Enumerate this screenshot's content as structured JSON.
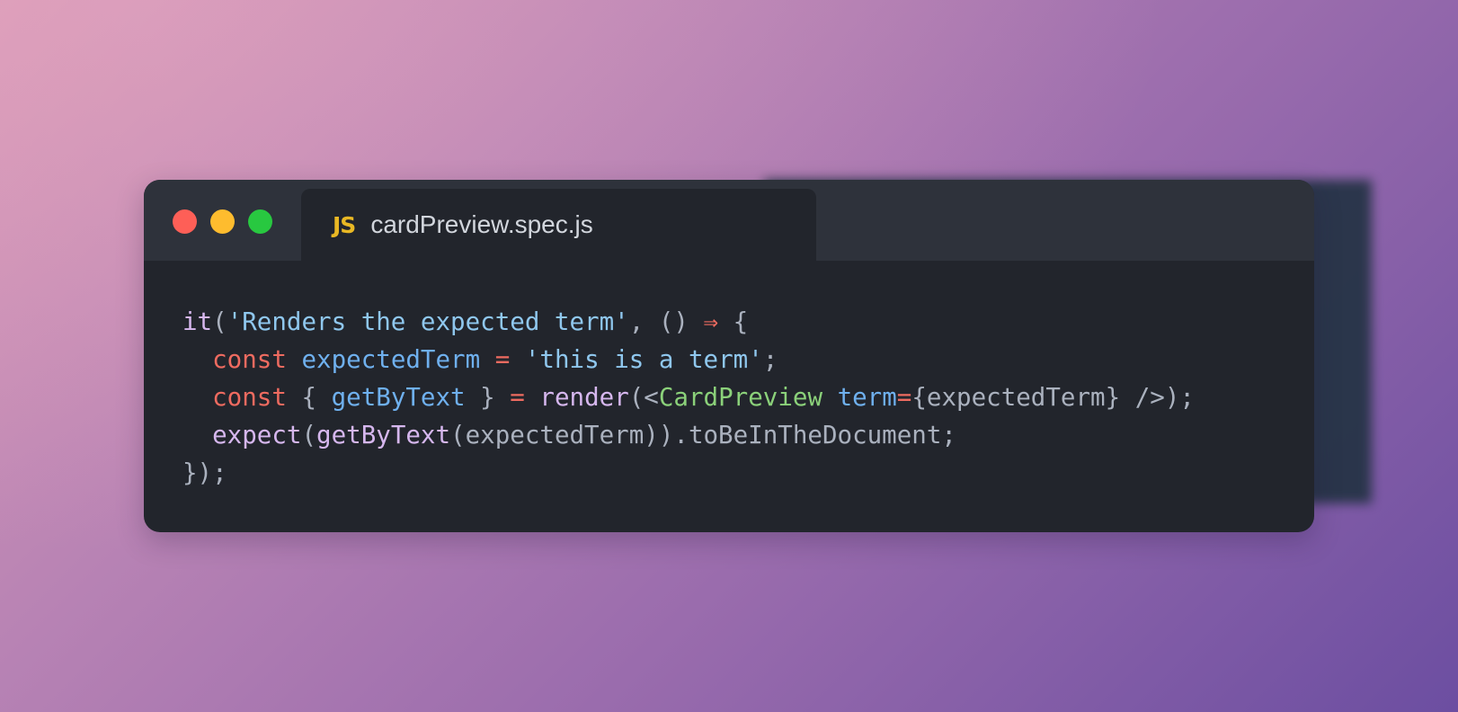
{
  "window": {
    "tab_icon": "JS",
    "filename": "cardPreview.spec.js",
    "traffic_lights": [
      {
        "name": "close",
        "color": "#fe5f57"
      },
      {
        "name": "minimize",
        "color": "#febc2e"
      },
      {
        "name": "zoom",
        "color": "#28c840"
      }
    ]
  },
  "code": {
    "lines": [
      [
        {
          "text": "it",
          "kind": "fn"
        },
        {
          "text": "(",
          "kind": "p"
        },
        {
          "text": "'Renders the expected term'",
          "kind": "str"
        },
        {
          "text": ", () ",
          "kind": "p"
        },
        {
          "text": "⇒",
          "kind": "op"
        },
        {
          "text": " {",
          "kind": "p"
        }
      ],
      [
        {
          "text": "  ",
          "kind": "p"
        },
        {
          "text": "const",
          "kind": "kw"
        },
        {
          "text": " ",
          "kind": "p"
        },
        {
          "text": "expectedTerm",
          "kind": "var"
        },
        {
          "text": " ",
          "kind": "p"
        },
        {
          "text": "=",
          "kind": "op"
        },
        {
          "text": " ",
          "kind": "p"
        },
        {
          "text": "'this is a term'",
          "kind": "str"
        },
        {
          "text": ";",
          "kind": "p"
        }
      ],
      [
        {
          "text": "  ",
          "kind": "p"
        },
        {
          "text": "const",
          "kind": "kw"
        },
        {
          "text": " { ",
          "kind": "p"
        },
        {
          "text": "getByText",
          "kind": "var"
        },
        {
          "text": " } ",
          "kind": "p"
        },
        {
          "text": "=",
          "kind": "op"
        },
        {
          "text": " ",
          "kind": "p"
        },
        {
          "text": "render",
          "kind": "fn"
        },
        {
          "text": "(<",
          "kind": "p"
        },
        {
          "text": "CardPreview",
          "kind": "comp"
        },
        {
          "text": " ",
          "kind": "p"
        },
        {
          "text": "term",
          "kind": "var"
        },
        {
          "text": "=",
          "kind": "op"
        },
        {
          "text": "{expectedTerm} ",
          "kind": "p"
        },
        {
          "text": "/>",
          "kind": "p"
        },
        {
          "text": ");",
          "kind": "p"
        }
      ],
      [
        {
          "text": "  ",
          "kind": "p"
        },
        {
          "text": "expect",
          "kind": "fn"
        },
        {
          "text": "(",
          "kind": "p"
        },
        {
          "text": "getByText",
          "kind": "fn"
        },
        {
          "text": "(expectedTerm)).toBeInTheDocument;",
          "kind": "p"
        }
      ],
      [
        {
          "text": "});",
          "kind": "p"
        }
      ]
    ]
  }
}
